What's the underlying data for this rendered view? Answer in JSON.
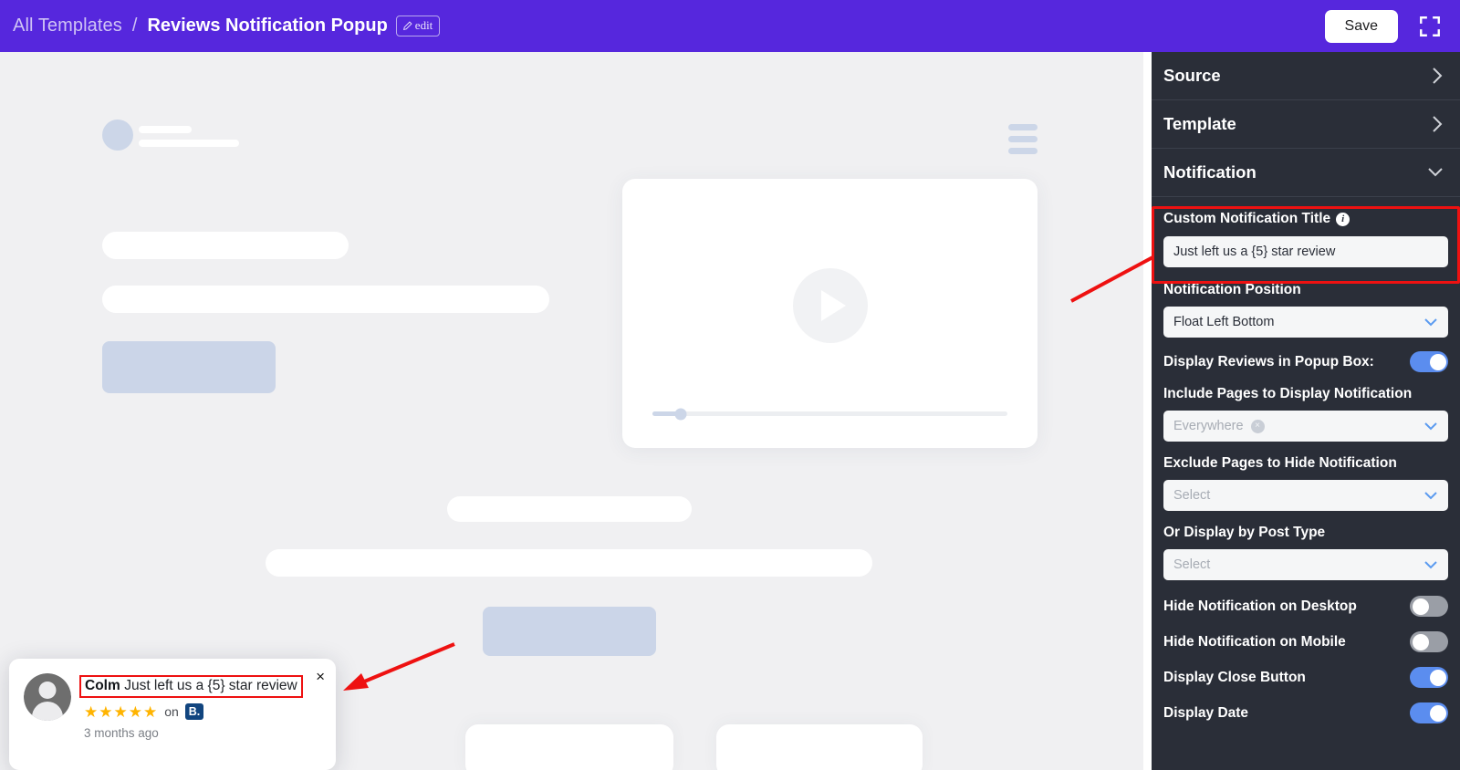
{
  "header": {
    "breadcrumb_root": "All Templates",
    "breadcrumb_sep": "/",
    "breadcrumb_current": "Reviews Notification Popup",
    "edit_label": "edit",
    "save_label": "Save",
    "fullscreen_icon": "fullscreen-icon",
    "brand_color": "#5627dd"
  },
  "sidebar": {
    "sections": [
      {
        "label": "Source",
        "state": "collapsed",
        "chevron": "›"
      },
      {
        "label": "Template",
        "state": "collapsed",
        "chevron": "›"
      },
      {
        "label": "Notification",
        "state": "expanded",
        "chevron": "⌄"
      }
    ],
    "fields": {
      "custom_title": {
        "label": "Custom Notification Title",
        "info_icon": "info-icon",
        "value": "Just left us a {5} star review",
        "highlighted": true
      },
      "position": {
        "label": "Notification Position",
        "value": "Float Left Bottom"
      },
      "display_reviews": {
        "label": "Display Reviews in Popup Box:",
        "toggle": "on"
      },
      "include_pages": {
        "label": "Include Pages to Display Notification",
        "chip": "Everywhere",
        "chip_remove": "×"
      },
      "exclude_pages": {
        "label": "Exclude Pages to Hide Notification",
        "placeholder": "Select"
      },
      "post_type": {
        "label": "Or Display by Post Type",
        "placeholder": "Select"
      },
      "hide_desktop": {
        "label": "Hide Notification on Desktop",
        "toggle": "off"
      },
      "hide_mobile": {
        "label": "Hide Notification on Mobile",
        "toggle": "off"
      },
      "close_button": {
        "label": "Display Close Button",
        "toggle": "on"
      },
      "display_date": {
        "label": "Display Date",
        "toggle": "on"
      }
    },
    "colors": {
      "bg": "#2a2e38",
      "toggle_on": "#5b8def",
      "toggle_off": "#9a9ea6"
    }
  },
  "notification_preview": {
    "reviewer_name": "Colm",
    "message": "Just left us a {5} star review",
    "stars": "★★★★★",
    "star_count": 5,
    "on_label": "on",
    "source_badge": "B.",
    "timestamp": "3 months ago",
    "close_icon": "×",
    "avatar_icon": "avatar-placeholder-icon",
    "highlight_color": "#ee1111"
  },
  "canvas": {
    "play_icon": "play-icon",
    "menu_icon": "hamburger-menu-icon",
    "background": "#f0f0f2"
  }
}
